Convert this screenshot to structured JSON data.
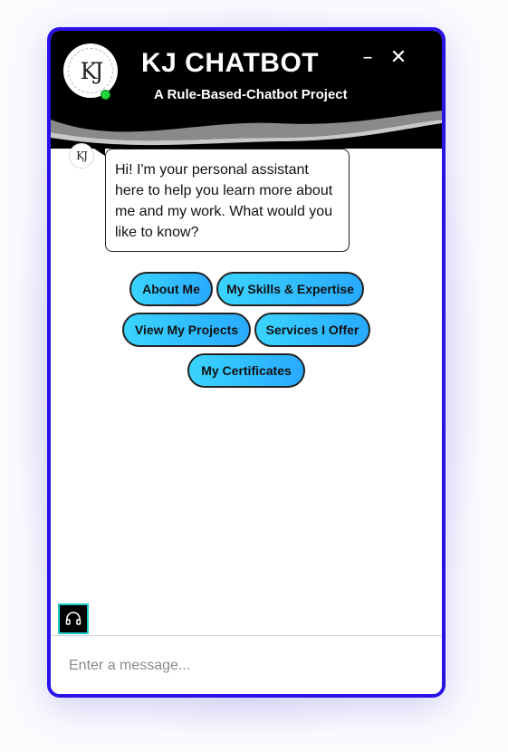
{
  "header": {
    "avatar_text": "KJ",
    "title": "KJ CHATBOT",
    "subtitle": "A Rule-Based-Chatbot Project",
    "minimize_symbol": "–",
    "close_symbol": "✕",
    "online_status_color": "#22d83a",
    "background_color": "#000000"
  },
  "chat": {
    "bot_avatar_text": "KJ",
    "message": "Hi! I'm your personal assistant here to help you learn more about me and my work. What would you like to know?"
  },
  "quick_replies": [
    {
      "label": "About Me"
    },
    {
      "label": "My Skills & Expertise"
    },
    {
      "label": "View My Projects"
    },
    {
      "label": "Services I Offer"
    },
    {
      "label": "My Certificates"
    }
  ],
  "agent_button": {
    "icon": "headset-icon"
  },
  "input": {
    "placeholder": "Enter a message...",
    "value": ""
  },
  "colors": {
    "frame_border": "#2a12e6",
    "chip_gradient_start": "#3ad4ff",
    "chip_gradient_end": "#28aaff"
  }
}
